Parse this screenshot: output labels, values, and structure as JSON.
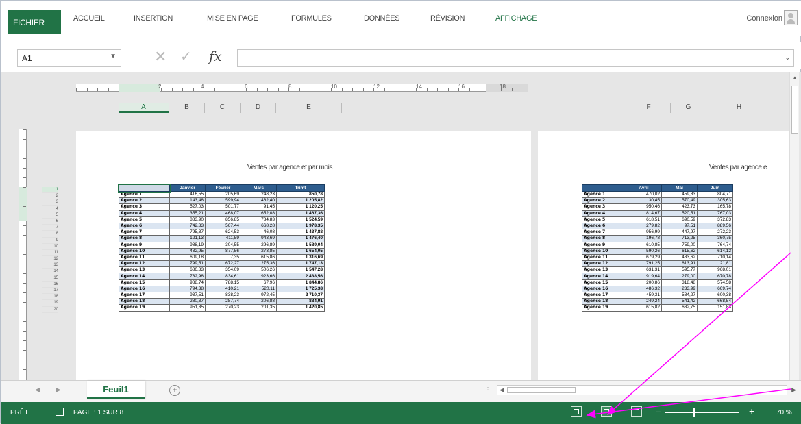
{
  "ribbon": {
    "tabs": [
      "FICHIER",
      "ACCUEIL",
      "INSERTION",
      "MISE EN PAGE",
      "FORMULES",
      "DONNÉES",
      "RÉVISION",
      "AFFICHAGE"
    ],
    "signin": "Connexion"
  },
  "formula_bar": {
    "name_box": "A1",
    "formula": ""
  },
  "ruler": {
    "labels": [
      "2",
      "4",
      "6",
      "8",
      "10",
      "12",
      "14",
      "16",
      "18"
    ]
  },
  "columns": [
    "A",
    "B",
    "C",
    "D",
    "E",
    "F",
    "G",
    "H"
  ],
  "page1": {
    "title": "Ventes par agence et par mois",
    "headers": [
      "",
      "Janvier",
      "Février",
      "Mars",
      "Trimt"
    ]
  },
  "page2": {
    "title": "Ventes par agence e",
    "headers": [
      "",
      "Avril",
      "Mai",
      "Juin"
    ]
  },
  "rows1": [
    [
      "Agence 1",
      "416,55",
      "205,69",
      "248,23",
      "850,78"
    ],
    [
      "Agence 2",
      "143,48",
      "599,94",
      "462,40",
      "1 205,82"
    ],
    [
      "Agence 3",
      "527,03",
      "501,77",
      "91,45",
      "1 120,25"
    ],
    [
      "Agence 4",
      "355,21",
      "468,07",
      "652,08",
      "1 467,36"
    ],
    [
      "Agence 5",
      "883,90",
      "856,85",
      "784,83",
      "1 524,59"
    ],
    [
      "Agence 6",
      "742,83",
      "567,44",
      "668,28",
      "1 978,35"
    ],
    [
      "Agence 7",
      "795,37",
      "624,53",
      "46,08",
      "1 437,88"
    ],
    [
      "Agence 8",
      "121,13",
      "411,59",
      "943,69",
      "1 476,40"
    ],
    [
      "Agence 9",
      "988,19",
      "304,55",
      "296,89",
      "1 589,04"
    ],
    [
      "Agence 10",
      "432,95",
      "877,56",
      "273,85",
      "1 654,05"
    ],
    [
      "Agence 11",
      "609,18",
      "7,35",
      "615,86",
      "1 316,69"
    ],
    [
      "Agence 12",
      "799,51",
      "672,27",
      "275,36",
      "1 747,13"
    ],
    [
      "Agence 13",
      "686,83",
      "354,09",
      "506,26",
      "1 547,28"
    ],
    [
      "Agence 14",
      "732,98",
      "834,61",
      "923,66",
      "2 438,56"
    ],
    [
      "Agence 15",
      "988,74",
      "788,15",
      "67,96",
      "1 844,86"
    ],
    [
      "Agence 16",
      "794,38",
      "410,21",
      "520,11",
      "1 725,38"
    ],
    [
      "Agence 17",
      "937,51",
      "838,23",
      "972,45",
      "2 710,37"
    ],
    [
      "Agence 18",
      "280,37",
      "287,74",
      "206,88",
      "884,91"
    ],
    [
      "Agence 19",
      "951,35",
      "270,23",
      "201,35",
      "1 420,85"
    ]
  ],
  "rows2": [
    [
      "Agence 1",
      "470,02",
      "459,83",
      "804,71"
    ],
    [
      "Agence 2",
      "30,45",
      "570,49",
      "305,63"
    ],
    [
      "Agence 3",
      "950,46",
      "423,73",
      "165,78"
    ],
    [
      "Agence 4",
      "814,67",
      "520,51",
      "767,03"
    ],
    [
      "Agence 5",
      "618,51",
      "690,59",
      "372,83"
    ],
    [
      "Agence 6",
      "279,82",
      "97,51",
      "889,56"
    ],
    [
      "Agence 7",
      "956,99",
      "447,97",
      "272,23"
    ],
    [
      "Agence 8",
      "196,78",
      "713,25",
      "360,75"
    ],
    [
      "Agence 9",
      "610,85",
      "759,00",
      "764,74"
    ],
    [
      "Agence 10",
      "590,26",
      "615,62",
      "614,12"
    ],
    [
      "Agence 11",
      "679,29",
      "433,62",
      "710,14"
    ],
    [
      "Agence 12",
      "791,25",
      "613,91",
      "21,81"
    ],
    [
      "Agence 13",
      "631,31",
      "595,77",
      "968,01"
    ],
    [
      "Agence 14",
      "919,64",
      "279,00",
      "670,78"
    ],
    [
      "Agence 15",
      "200,86",
      "318,48",
      "574,58"
    ],
    [
      "Agence 16",
      "486,32",
      "233,99",
      "669,74"
    ],
    [
      "Agence 17",
      "459,31",
      "584,27",
      "600,38"
    ],
    [
      "Agence 18",
      "249,24",
      "541,42",
      "668,54"
    ],
    [
      "Agence 19",
      "615,82",
      "632,75",
      "151,83"
    ]
  ],
  "sheet_tab": "Feuil1",
  "status": {
    "ready": "PRÊT",
    "page": "PAGE : 1 SUR 8",
    "zoom": "70 %"
  },
  "colors": {
    "accent": "#217346",
    "table_header": "#2e5d8e",
    "arrow": "#ff00ff"
  }
}
